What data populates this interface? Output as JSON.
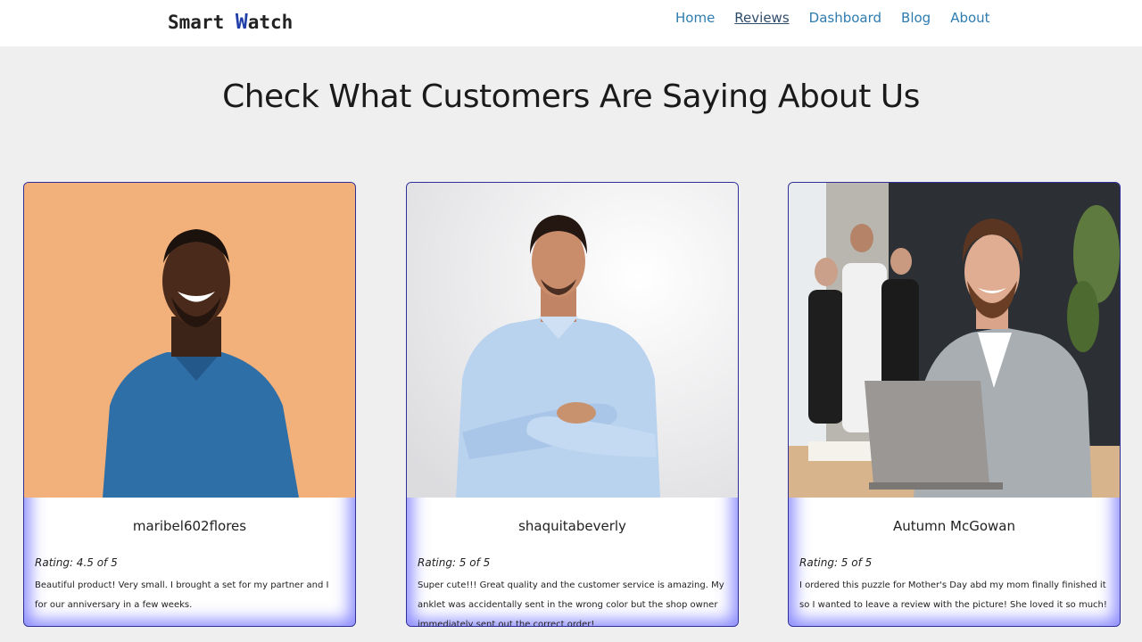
{
  "navbar": {
    "brand_prefix": "Smart ",
    "brand_w": "W",
    "brand_rest": "atch",
    "links": [
      "Home",
      "Reviews",
      "Dashboard",
      "Blog",
      "About"
    ],
    "active_link": "Reviews"
  },
  "page": {
    "heading": "Check What Customers Are Saying About Us"
  },
  "reviews": [
    {
      "name": "maribel602flores",
      "rating": "Rating: 4.5 of 5",
      "text": "Beautiful product! Very small. I brought a set for my partner and I for our anniversary in a few weeks.",
      "photo_bg": "#f2b07a"
    },
    {
      "name": "shaquitabeverly",
      "rating": "Rating: 5 of 5",
      "text": "Super cute!!! Great quality and the customer service is amazing. My anklet was accidentally sent in the wrong color but the shop owner immediately sent out the correct order!",
      "photo_bg": "#e9e9ec"
    },
    {
      "name": "Autumn McGowan",
      "rating": "Rating: 5 of 5",
      "text": "I ordered this puzzle for Mother's Day abd my mom finally finished it so I wanted to leave a review with the picture! She loved it so much!",
      "photo_bg": "#3b3e42"
    }
  ],
  "colors": {
    "background": "#efefef",
    "nav_link": "#2e7cb0",
    "card_glow": "#7373ff",
    "card_border": "#2f2f9a"
  }
}
